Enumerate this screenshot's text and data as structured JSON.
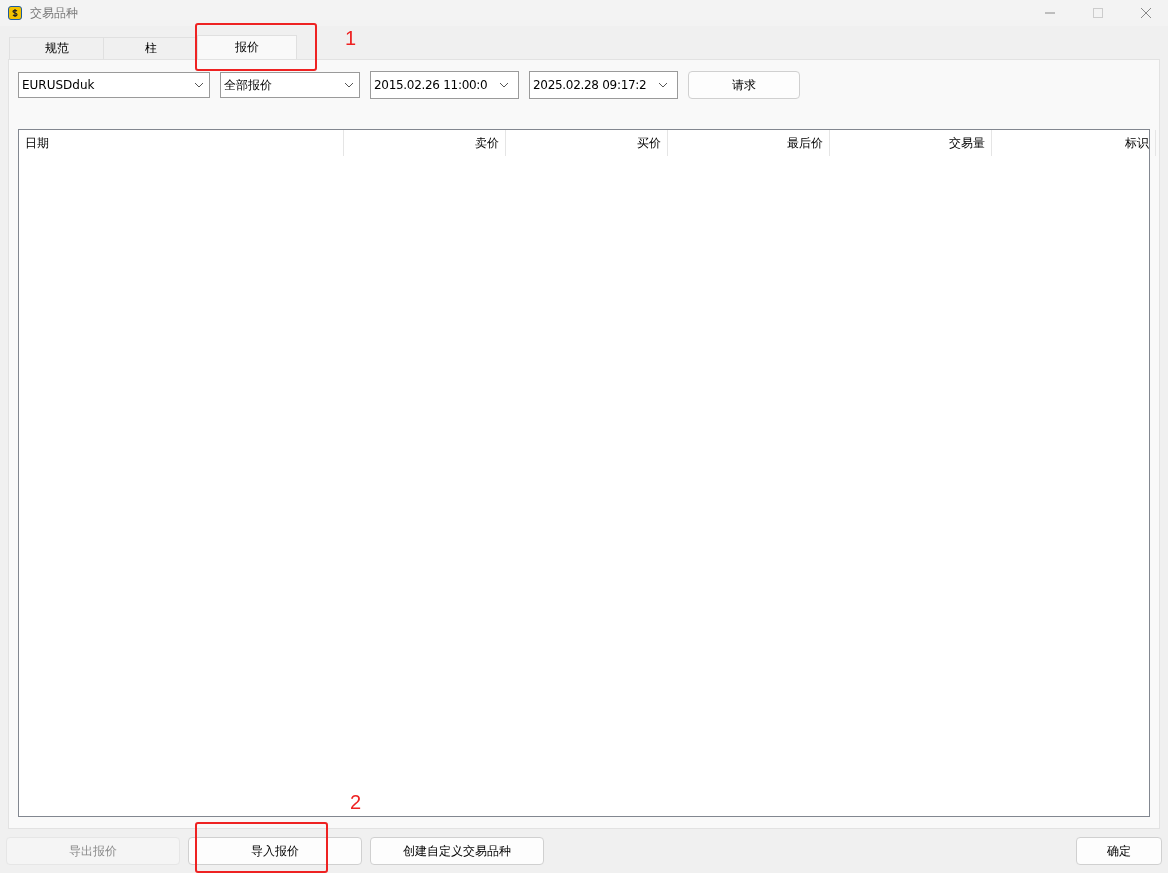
{
  "window": {
    "title": "交易品种"
  },
  "tabs": [
    {
      "label": "规范",
      "selected": false
    },
    {
      "label": "柱",
      "selected": false
    },
    {
      "label": "报价",
      "selected": true
    }
  ],
  "filters": {
    "symbol": "EURUSDduk",
    "tick_type": "全部报价",
    "date_from": "2015.02.26 11:00:0",
    "date_to": "2025.02.28 09:17:2",
    "request_button": "请求"
  },
  "table": {
    "columns": [
      "日期",
      "卖价",
      "买价",
      "最后价",
      "交易量",
      "标识"
    ]
  },
  "buttons": [
    {
      "label": "导出报价",
      "disabled": true
    },
    {
      "label": "导入报价",
      "disabled": false
    },
    {
      "label": "创建自定义交易品种",
      "disabled": false
    }
  ],
  "ok_button": "确定",
  "annotations": [
    {
      "label": "1"
    },
    {
      "label": "2"
    }
  ]
}
